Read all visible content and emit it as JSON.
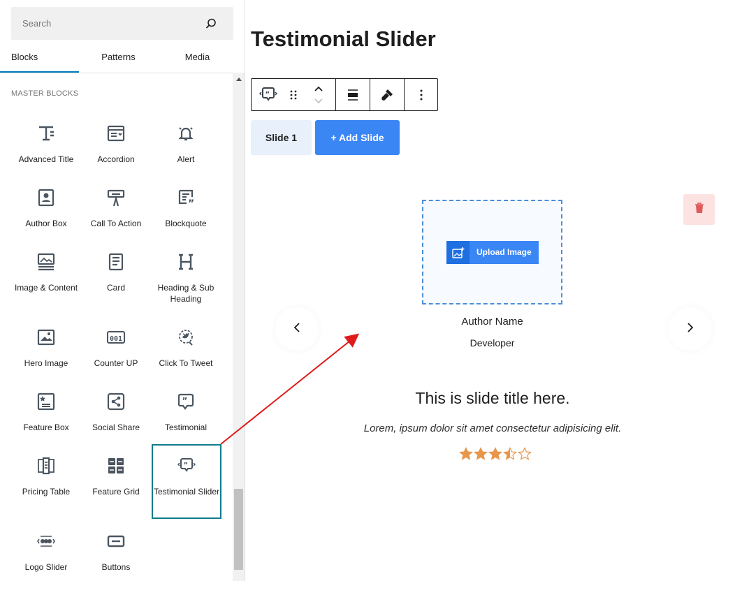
{
  "sidebar": {
    "search_placeholder": "Search",
    "tabs": [
      {
        "label": "Blocks"
      },
      {
        "label": "Patterns"
      },
      {
        "label": "Media"
      }
    ],
    "category_label": "MASTER BLOCKS",
    "blocks": [
      {
        "label": "Advanced Title",
        "icon": "advanced-title-icon"
      },
      {
        "label": "Accordion",
        "icon": "accordion-icon"
      },
      {
        "label": "Alert",
        "icon": "bell-icon"
      },
      {
        "label": "Author Box",
        "icon": "author-box-icon"
      },
      {
        "label": "Call To Action",
        "icon": "call-to-action-icon"
      },
      {
        "label": "Blockquote",
        "icon": "blockquote-icon"
      },
      {
        "label": "Image & Content",
        "icon": "image-content-icon"
      },
      {
        "label": "Card",
        "icon": "card-icon"
      },
      {
        "label": "Heading & Sub Heading",
        "icon": "heading-icon"
      },
      {
        "label": "Hero Image",
        "icon": "hero-image-icon"
      },
      {
        "label": "Counter UP",
        "icon": "counter-icon"
      },
      {
        "label": "Click To Tweet",
        "icon": "tweet-icon"
      },
      {
        "label": "Feature Box",
        "icon": "feature-box-icon"
      },
      {
        "label": "Social Share",
        "icon": "share-icon"
      },
      {
        "label": "Testimonial",
        "icon": "testimonial-icon"
      },
      {
        "label": "Pricing Table",
        "icon": "pricing-table-icon"
      },
      {
        "label": "Feature Grid",
        "icon": "feature-grid-icon"
      },
      {
        "label": "Testimonial Slider",
        "icon": "testimonial-slider-icon",
        "selected": true
      },
      {
        "label": "Logo Slider",
        "icon": "logo-slider-icon"
      },
      {
        "label": "Buttons",
        "icon": "buttons-icon"
      }
    ]
  },
  "editor": {
    "page_title": "Testimonial Slider",
    "toolbar": [
      "testimonial-slider-icon",
      "drag-handle-icon",
      "move-up-down-icon",
      "align-icon",
      "brush-icon",
      "more-options-icon"
    ],
    "slide_tab_label": "Slide 1",
    "add_slide_label": "+ Add Slide",
    "upload_image_label": "Upload Image",
    "author_name": "Author Name",
    "designation": "Developer",
    "slide_title": "This is slide title here.",
    "slide_description": "Lorem, ipsum dolor sit amet consectetur adipisicing elit.",
    "rating": 3.5,
    "rating_max": 5
  },
  "colors": {
    "accent": "#007cba",
    "selected_border": "#107c8c",
    "primary_button": "#3b86f5",
    "delete_bg": "#fde2e2",
    "delete_icon": "#e05a5a",
    "star": "#e8964b",
    "annotation_arrow": "#e01b1b"
  }
}
